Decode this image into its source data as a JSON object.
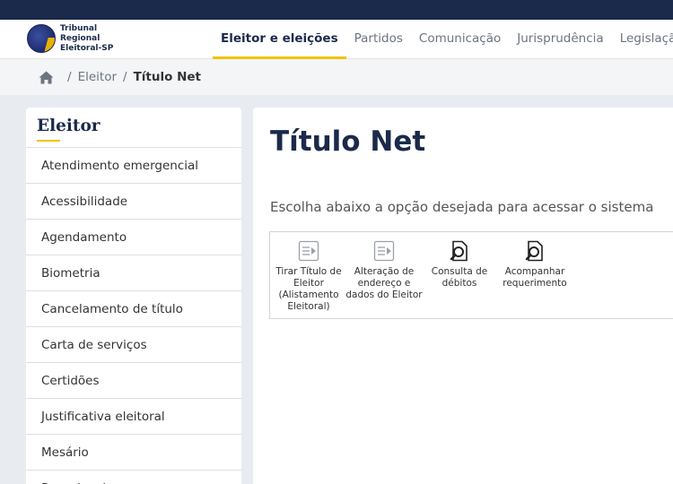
{
  "brand": {
    "lines": [
      "Tribunal",
      "Regional",
      "Eleitoral-SP"
    ]
  },
  "nav": [
    {
      "label": "Eleitor e eleições"
    },
    {
      "label": "Partidos"
    },
    {
      "label": "Comunicação"
    },
    {
      "label": "Jurisprudência"
    },
    {
      "label": "Legislação"
    }
  ],
  "breadcrumb": {
    "items": [
      "Eleitor",
      "Título Net"
    ]
  },
  "sidebar": {
    "title": "Eleitor",
    "items": [
      {
        "label": "Atendimento emergencial"
      },
      {
        "label": "Acessibilidade"
      },
      {
        "label": "Agendamento"
      },
      {
        "label": "Biometria"
      },
      {
        "label": "Cancelamento de título"
      },
      {
        "label": "Carta de serviços"
      },
      {
        "label": "Certidões"
      },
      {
        "label": "Justificativa eleitoral"
      },
      {
        "label": "Mesário"
      },
      {
        "label": "Pesquisa de zonas"
      }
    ]
  },
  "main": {
    "title": "Título Net",
    "intro": "Escolha abaixo a opção desejada para acessar o sistema",
    "options": [
      {
        "lines": [
          "Tirar Título de",
          "Eleitor",
          "(Alistamento",
          "Eleitoral)"
        ],
        "icon": "form-arrow-icon"
      },
      {
        "lines": [
          "Alteração de",
          "endereço e",
          "dados do Eleitor"
        ],
        "icon": "form-arrow-icon"
      },
      {
        "lines": [
          "Consulta de",
          "débitos"
        ],
        "icon": "document-search-icon"
      },
      {
        "lines": [
          "Acompanhar",
          "requerimento"
        ],
        "icon": "document-search-icon"
      }
    ]
  },
  "colors": {
    "navy": "#1b2a4a",
    "accent": "#f2c200"
  }
}
